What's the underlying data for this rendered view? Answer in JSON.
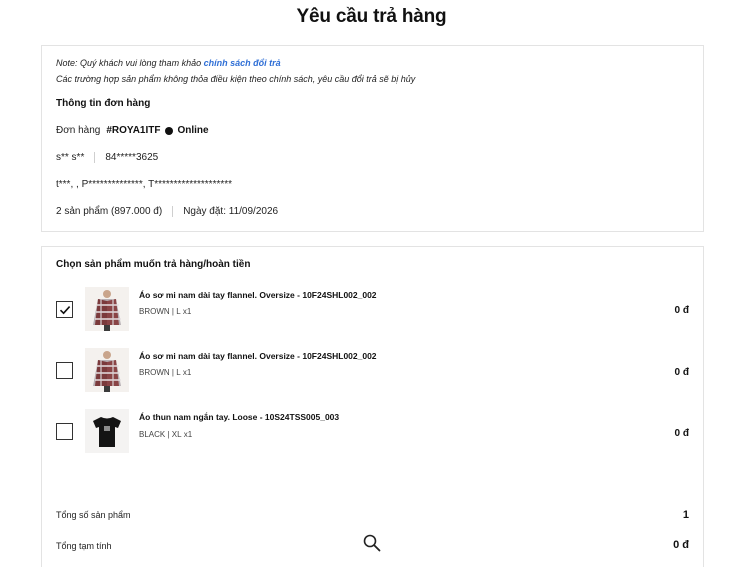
{
  "page": {
    "title": "Yêu cầu trả hàng"
  },
  "order_info": {
    "note_prefix": "Note: Quý khách vui lòng tham khảo",
    "note_link": "chính sách đổi trả",
    "note_line2": "Các trường hợp sản phẩm không thỏa điều kiện theo chính sách, yêu cầu đổi trả sẽ bị hủy",
    "section_title": "Thông tin đơn hàng",
    "order_label": "Đơn hàng",
    "order_code": "#ROYA1ITF",
    "channel": "Online",
    "customer_name": "s** s**",
    "phone": "84*****3625",
    "address": "t***, , P**************, T********************",
    "products_summary": "2 sản phẩm (897.000 đ)",
    "order_date": "Ngày đặt: 11/09/2026"
  },
  "product_select": {
    "section_title": "Chọn sản phẩm muốn trả hàng/hoàn tiền",
    "items": [
      {
        "name": "Áo sơ mi nam dài tay flannel. Oversize - 10F24SHL002_002",
        "variant": "BROWN | L",
        "qty": "x1",
        "price": "0 đ",
        "checked": true
      },
      {
        "name": "Áo sơ mi nam dài tay flannel. Oversize - 10F24SHL002_002",
        "variant": "BROWN | L",
        "qty": "x1",
        "price": "0 đ",
        "checked": false
      },
      {
        "name": "Áo thun nam ngắn tay. Loose - 10S24TSS005_003",
        "variant": "BLACK | XL",
        "qty": "x1",
        "price": "0 đ",
        "checked": false
      }
    ],
    "total_count_label": "Tổng số sản phẩm",
    "total_count_value": "1",
    "subtotal_label": "Tổng tạm tính",
    "subtotal_value": "0 đ"
  },
  "colors": {
    "link": "#2f6fd6",
    "border": "#e3e3e3",
    "text": "#111111"
  },
  "icons": {
    "zoom": "magnifier-icon",
    "check": "checkmark-icon"
  }
}
